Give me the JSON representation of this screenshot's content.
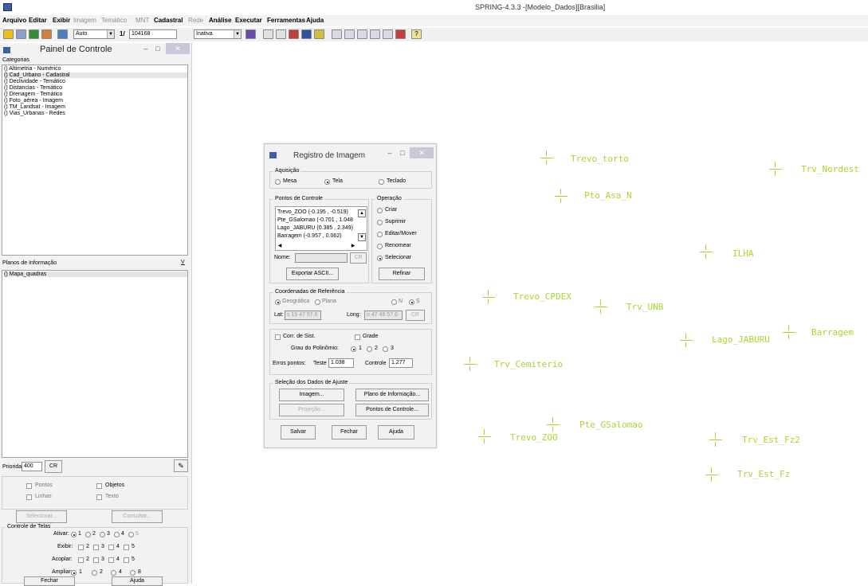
{
  "app": {
    "title": "SPRING-4.3.3 -[Modelo_Dados][Brasilia]"
  },
  "menu": {
    "items": [
      "Arquivo",
      "Editar",
      "Exibir",
      "Imagem",
      "Temático",
      "MNT",
      "Cadastral",
      "Rede",
      "Análise",
      "Executar",
      "Ferramentas",
      "Ajuda"
    ]
  },
  "toolbar": {
    "scale_mode": "Auto",
    "scale_prefix": "1/",
    "scale_value": "104168",
    "mode": "Inativa"
  },
  "panel": {
    "title": "Painel de Controle",
    "categories_label": "Categorias",
    "categories": [
      "() Altimetria - Numérico",
      "() Cad_Urbano - Cadastral",
      "() Declividade - Temático",
      "() Distancias - Temático",
      "() Drenagem - Temático",
      "() Foto_aérea - Imagem",
      "() TM_Landsat - Imagem",
      "() Vias_Urbanas - Redes"
    ],
    "planos_label": "Planos de Informação",
    "planos_v": "V",
    "planos": [
      "() Mapa_quadras"
    ],
    "prioridade_label": "Prioridade:",
    "prioridade_value": "400",
    "cr_label": "CR",
    "chk_pontos": "Pontos",
    "chk_objetos": "Objetos",
    "chk_linhas": "Linhas",
    "chk_texto": "Texto",
    "selecionar_label": "Selecionar...",
    "consultar_label": "Consultar...",
    "controle_label": "Controle de Telas",
    "ativar_label": "Ativar:",
    "exibir_label": "Exibir:",
    "acoplar_label": "Acoplar:",
    "ampliar_label": "Ampliar:",
    "nums_ativar": [
      "1",
      "2",
      "3",
      "4",
      "5"
    ],
    "nums_exibir": [
      "2",
      "3",
      "4",
      "5"
    ],
    "nums_ampliar": [
      "1",
      "2",
      "4",
      "8"
    ],
    "fechar_label": "Fechar",
    "ajuda_label": "Ajuda"
  },
  "dialog": {
    "title": "Registro de Imagem",
    "aquisicao_label": "Aquisição",
    "opt_mesa": "Mesa",
    "opt_tela": "Tela",
    "opt_teclado": "Teclado",
    "pontos_label": "Pontos de Controle",
    "pontos": [
      "Trevo_ZOO (-0.195 , -0.519)",
      "Pte_GSalomao (-0.701 , 1.048",
      "Lago_JABURU (0.385 , 2.349)",
      "Barragem (-0.957 , 0.062)"
    ],
    "nome_label": "Nome:",
    "cr_label": "CR",
    "exportar_label": "Exportar ASCII...",
    "operacao_label": "Operação",
    "op_criar": "Criar",
    "op_suprimir": "Suprimir",
    "op_editar": "Editar/Mover",
    "op_renomear": "Renomear",
    "op_selecionar": "Selecionar",
    "refinar_label": "Refinar",
    "coord_label": "Coordenadas de Referência",
    "opt_geografica": "Geográfica",
    "opt_plana": "Plana",
    "opt_n": "N",
    "opt_s": "S",
    "lat_label": "Lat:",
    "lat_value": "s 15 47 57.6",
    "long_label": "Long:",
    "long_value": "o 47 49 57.6",
    "corr_label": "Corr. de Sist.",
    "grade_label": "Grade",
    "grau_label": "Grau do Polinômio:",
    "grau_1": "1",
    "grau_2": "2",
    "grau_3": "3",
    "erros_label": "Erros pontos:",
    "teste_label": "Teste",
    "teste_value": "1.038",
    "controle_label": "Controle",
    "controle_value": "1.277",
    "selecao_label": "Seleção dos Dados de Ajuste",
    "imagem_label": "Imagem...",
    "plano_label": "Plano de Informação...",
    "projecao_label": "Projeção...",
    "pontos_ctrl_label": "Pontos de Controle...",
    "salvar_label": "Salvar",
    "fechar_label": "Fechar",
    "ajuda_label": "Ajuda"
  },
  "map": {
    "color": "#a8d630",
    "points": [
      "Trevo_torto",
      "Trv_Nordest",
      "Pto_Asa_N",
      "ILHA",
      "Trevo_CPDEX",
      "Trv_UNB",
      "Lago_JABURU",
      "Barragem",
      "Trv_Cemiterio",
      "Pte_GSalomao",
      "Trevo_ZOO",
      "Trv_Est_Fz2",
      "Trv_Est_Fz"
    ]
  }
}
